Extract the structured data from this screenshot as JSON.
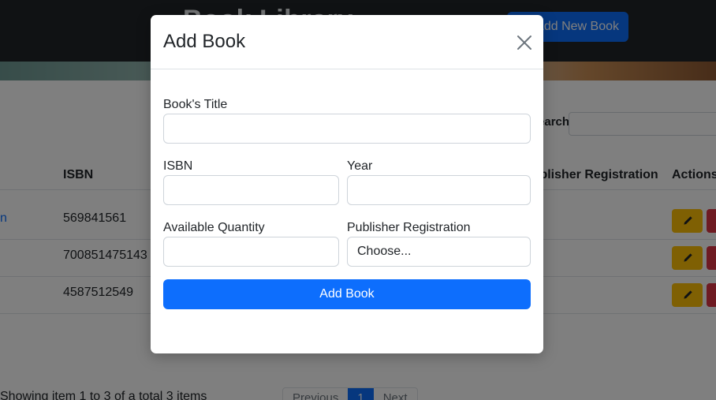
{
  "navbar": {
    "brand": "Book Library",
    "add_new_label": "Add New Book"
  },
  "toolbar": {
    "search_label": "Search"
  },
  "table": {
    "headers": {
      "isbn": "ISBN",
      "registration": "Publisher Registration",
      "actions": "Actions"
    },
    "rows": [
      {
        "isbn": "569841561"
      },
      {
        "isbn": "700851475143"
      },
      {
        "isbn": "4587512549"
      }
    ]
  },
  "footer": {
    "summary": "Showing item 1 to 3 of a total 3 items",
    "pagination": {
      "previous": "Previous",
      "current": "1",
      "next": "Next"
    }
  },
  "modal": {
    "title": "Add Book",
    "fields": {
      "title_label": "Book's Title",
      "isbn_label": "ISBN",
      "year_label": "Year",
      "quantity_label": "Available Quantity",
      "publisher_label": "Publisher Registration",
      "publisher_value": "Choose..."
    },
    "submit_label": "Add Book"
  },
  "colors": {
    "primary": "#0d6efd",
    "warning": "#ffc107",
    "danger": "#dc3545",
    "navbar": "#212529"
  },
  "icons": [
    "close-icon",
    "pencil-icon"
  ]
}
